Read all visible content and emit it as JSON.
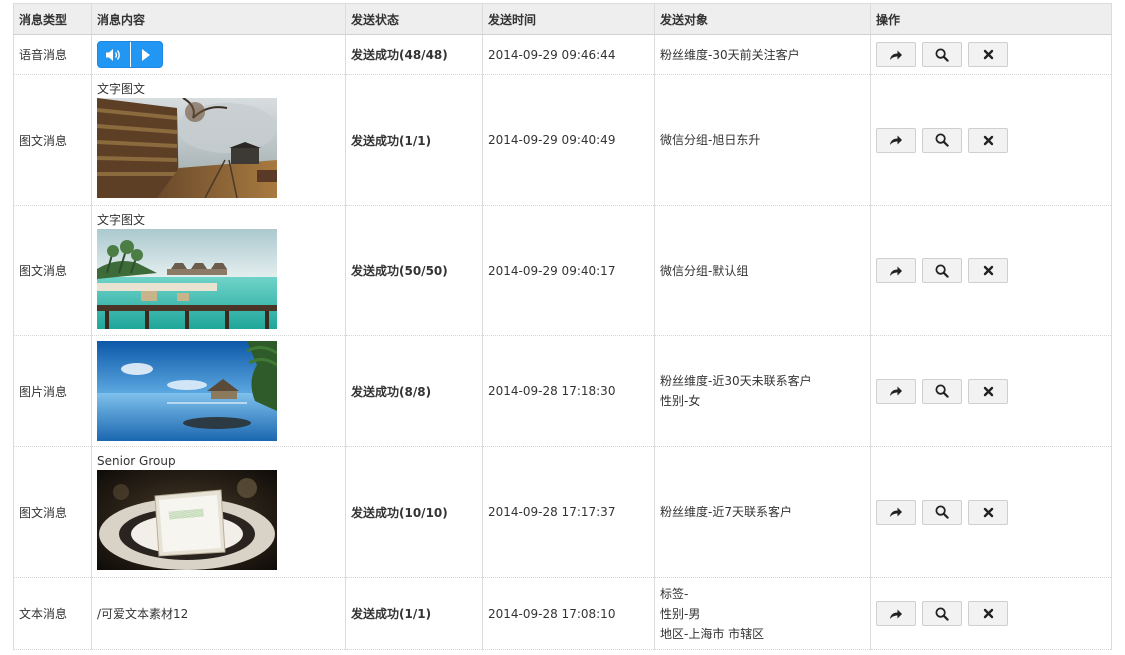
{
  "headers": {
    "type": "消息类型",
    "content": "消息内容",
    "status": "发送状态",
    "time": "发送时间",
    "target": "发送对象",
    "actions": "操作"
  },
  "rows": [
    {
      "type": "语音消息",
      "content_kind": "voice",
      "status": "发送成功(48/48)",
      "time": "2014-09-29 09:46:44",
      "targets": [
        "粉丝维度-30天前关注客户"
      ]
    },
    {
      "type": "图文消息",
      "content_kind": "news",
      "content_title": "文字图文",
      "image": "railway-autumn-photo",
      "status": "发送成功(1/1)",
      "time": "2014-09-29 09:40:49",
      "targets": [
        "微信分组-旭日东升"
      ]
    },
    {
      "type": "图文消息",
      "content_kind": "news",
      "content_title": "文字图文",
      "image": "tropical-beach-photo",
      "status": "发送成功(50/50)",
      "time": "2014-09-29 09:40:17",
      "targets": [
        "微信分组-默认组"
      ]
    },
    {
      "type": "图片消息",
      "content_kind": "image",
      "image": "infinity-pool-photo",
      "status": "发送成功(8/8)",
      "time": "2014-09-28 17:18:30",
      "targets": [
        "粉丝维度-近30天未联系客户",
        "性别-女"
      ]
    },
    {
      "type": "图文消息",
      "content_kind": "news",
      "content_title": "Senior Group",
      "image": "banquet-table-card-photo",
      "status": "发送成功(10/10)",
      "time": "2014-09-28 17:17:37",
      "targets": [
        "粉丝维度-近7天联系客户"
      ]
    },
    {
      "type": "文本消息",
      "content_kind": "text",
      "content_text": "/可爱文本素材12",
      "status": "发送成功(1/1)",
      "time": "2014-09-28 17:08:10",
      "targets": [
        "标签-",
        "性别-男",
        "地区-上海市 市辖区"
      ]
    }
  ],
  "action_icons": [
    "share-icon",
    "search-icon",
    "close-icon"
  ],
  "colors": {
    "voice_button": "#2196f3",
    "header_bg": "#eeeeee"
  }
}
